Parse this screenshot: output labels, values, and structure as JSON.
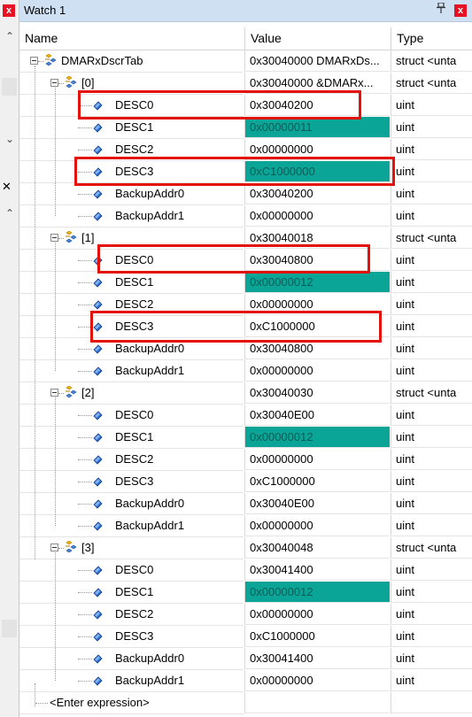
{
  "panel_title": "Watch 1",
  "pin_glyph": "ⱏ",
  "close_glyph": "x",
  "columns": {
    "name": "Name",
    "value": "Value",
    "type": "Type"
  },
  "rows": [
    {
      "name": "DMARxDscrTab",
      "value": "0x30040000 DMARxDs...",
      "type": "struct <unta",
      "level": 0,
      "kind": "struct"
    },
    {
      "name": "[0]",
      "value": "0x30040000 &DMARx...",
      "type": "struct <unta",
      "level": 1,
      "kind": "struct"
    },
    {
      "name": "DESC0",
      "value": "0x30040200",
      "type": "uint",
      "level": 2,
      "kind": "field"
    },
    {
      "name": "DESC1",
      "value": "0x00000011",
      "type": "uint",
      "level": 2,
      "kind": "field",
      "changed": true
    },
    {
      "name": "DESC2",
      "value": "0x00000000",
      "type": "uint",
      "level": 2,
      "kind": "field"
    },
    {
      "name": "DESC3",
      "value": "0xC1000000",
      "type": "uint",
      "level": 2,
      "kind": "field",
      "changed": true
    },
    {
      "name": "BackupAddr0",
      "value": "0x30040200",
      "type": "uint",
      "level": 2,
      "kind": "field"
    },
    {
      "name": "BackupAddr1",
      "value": "0x00000000",
      "type": "uint",
      "level": 2,
      "kind": "field"
    },
    {
      "name": "[1]",
      "value": "0x30040018",
      "type": "struct <unta",
      "level": 1,
      "kind": "struct"
    },
    {
      "name": "DESC0",
      "value": "0x30040800",
      "type": "uint",
      "level": 2,
      "kind": "field"
    },
    {
      "name": "DESC1",
      "value": "0x00000012",
      "type": "uint",
      "level": 2,
      "kind": "field",
      "changed": true
    },
    {
      "name": "DESC2",
      "value": "0x00000000",
      "type": "uint",
      "level": 2,
      "kind": "field"
    },
    {
      "name": "DESC3",
      "value": "0xC1000000",
      "type": "uint",
      "level": 2,
      "kind": "field"
    },
    {
      "name": "BackupAddr0",
      "value": "0x30040800",
      "type": "uint",
      "level": 2,
      "kind": "field"
    },
    {
      "name": "BackupAddr1",
      "value": "0x00000000",
      "type": "uint",
      "level": 2,
      "kind": "field"
    },
    {
      "name": "[2]",
      "value": "0x30040030",
      "type": "struct <unta",
      "level": 1,
      "kind": "struct"
    },
    {
      "name": "DESC0",
      "value": "0x30040E00",
      "type": "uint",
      "level": 2,
      "kind": "field"
    },
    {
      "name": "DESC1",
      "value": "0x00000012",
      "type": "uint",
      "level": 2,
      "kind": "field",
      "changed": true
    },
    {
      "name": "DESC2",
      "value": "0x00000000",
      "type": "uint",
      "level": 2,
      "kind": "field"
    },
    {
      "name": "DESC3",
      "value": "0xC1000000",
      "type": "uint",
      "level": 2,
      "kind": "field"
    },
    {
      "name": "BackupAddr0",
      "value": "0x30040E00",
      "type": "uint",
      "level": 2,
      "kind": "field"
    },
    {
      "name": "BackupAddr1",
      "value": "0x00000000",
      "type": "uint",
      "level": 2,
      "kind": "field"
    },
    {
      "name": "[3]",
      "value": "0x30040048",
      "type": "struct <unta",
      "level": 1,
      "kind": "struct"
    },
    {
      "name": "DESC0",
      "value": "0x30041400",
      "type": "uint",
      "level": 2,
      "kind": "field"
    },
    {
      "name": "DESC1",
      "value": "0x00000012",
      "type": "uint",
      "level": 2,
      "kind": "field",
      "changed": true
    },
    {
      "name": "DESC2",
      "value": "0x00000000",
      "type": "uint",
      "level": 2,
      "kind": "field"
    },
    {
      "name": "DESC3",
      "value": "0xC1000000",
      "type": "uint",
      "level": 2,
      "kind": "field"
    },
    {
      "name": "BackupAddr0",
      "value": "0x30041400",
      "type": "uint",
      "level": 2,
      "kind": "field"
    },
    {
      "name": "BackupAddr1",
      "value": "0x00000000",
      "type": "uint",
      "level": 2,
      "kind": "field"
    }
  ],
  "enter_expression": "<Enter expression>",
  "colors": {
    "changed_value_bg": "#0aa596",
    "annotation_box": "#e3120b",
    "titlebar": "#cfe0f3"
  },
  "icons": {
    "struct": "struct-members-icon",
    "field": "blue-diamond-field-icon"
  }
}
